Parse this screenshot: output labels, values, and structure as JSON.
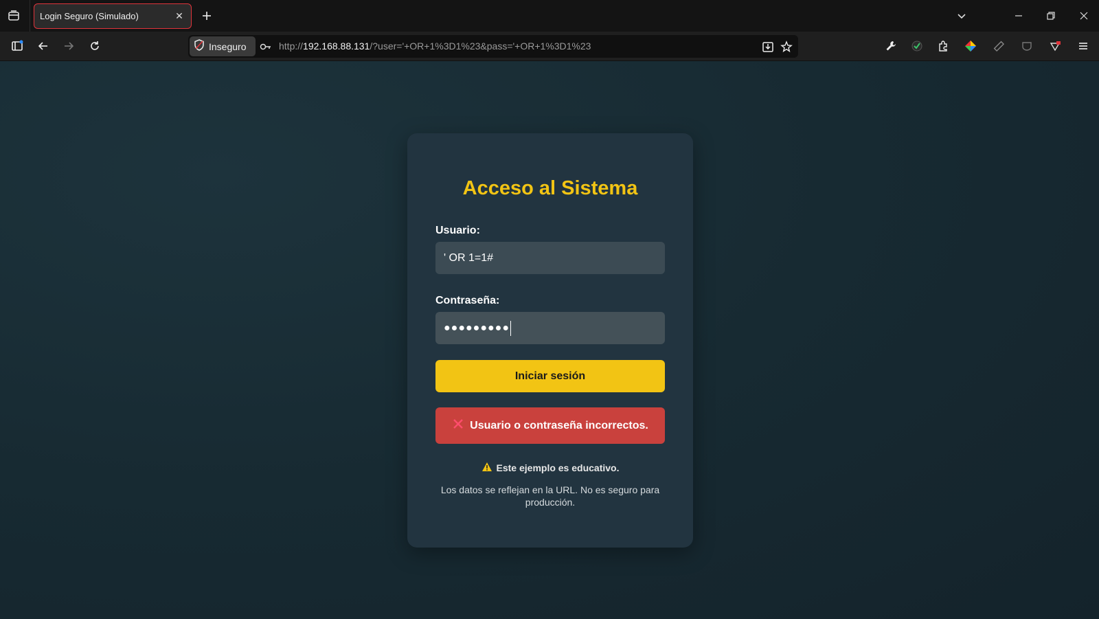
{
  "tab": {
    "title": "Login Seguro (Simulado)",
    "close_symbol": "✕"
  },
  "urlbar": {
    "security_label": "Inseguro",
    "url_scheme": "http://",
    "url_host": "192.168.88.131",
    "url_rest": "/?user='+OR+1%3D1%23&pass='+OR+1%3D1%23"
  },
  "login": {
    "title": "Acceso al Sistema",
    "user_label": "Usuario:",
    "user_value": "' OR 1=1#",
    "password_label": "Contraseña:",
    "password_mask": "●●●●●●●●●",
    "submit_label": "Iniciar sesión",
    "error_message": "Usuario o contraseña incorrectos.",
    "warning_text": "Este ejemplo es educativo.",
    "note_text": "Los datos se reflejan en la URL. No es seguro para producción."
  },
  "colors": {
    "accent": "#f2c414",
    "error": "#c9413d",
    "tab_border": "#e0333a"
  }
}
